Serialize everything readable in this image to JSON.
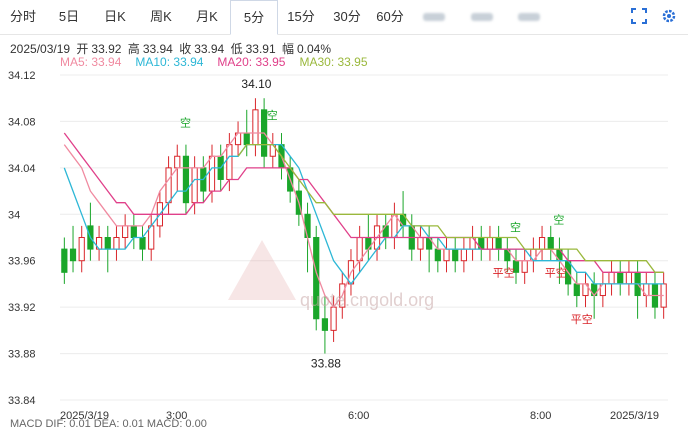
{
  "tabs": [
    {
      "label": "分时",
      "active": false,
      "blurred": false,
      "w": 46
    },
    {
      "label": "5日",
      "active": false,
      "blurred": false,
      "w": 46
    },
    {
      "label": "日K",
      "active": false,
      "blurred": false,
      "w": 46
    },
    {
      "label": "周K",
      "active": false,
      "blurred": false,
      "w": 46
    },
    {
      "label": "月K",
      "active": false,
      "blurred": false,
      "w": 46
    },
    {
      "label": "5分",
      "active": true,
      "blurred": false,
      "w": 46
    },
    {
      "label": "15分",
      "active": false,
      "blurred": false,
      "w": 46
    },
    {
      "label": "30分",
      "active": false,
      "blurred": false,
      "w": 46
    },
    {
      "label": "60分",
      "active": false,
      "blurred": false,
      "w": 40
    },
    {
      "label": "",
      "active": false,
      "blurred": true,
      "w": 48
    },
    {
      "label": "",
      "active": false,
      "blurred": true,
      "w": 48
    },
    {
      "label": "",
      "active": false,
      "blurred": true,
      "w": 46
    }
  ],
  "toolbar": {
    "fullscreen_icon": "fullscreen-icon",
    "settings_icon": "gear-icon"
  },
  "info": {
    "date": "2025/03/19",
    "open_label": "开",
    "open": "33.92",
    "high_label": "高",
    "high": "33.94",
    "close_label": "收",
    "close": "33.94",
    "low_label": "低",
    "low": "33.91",
    "range_label": "幅",
    "range": "0.04%"
  },
  "ma_legend": [
    {
      "label": "MA5: 33.94",
      "color": "#f08aa0"
    },
    {
      "label": "MA10: 33.94",
      "color": "#2db7d6"
    },
    {
      "label": "MA20: 33.95",
      "color": "#e0408a"
    },
    {
      "label": "MA30: 33.95",
      "color": "#9ab83c"
    }
  ],
  "watermark_text": "quote.cngold.org",
  "bottom_labels": "MACD  DIF: 0.01   DEA: 0.01   MACD: 0.00",
  "colors": {
    "up": "#d9252a",
    "down": "#1aa62a",
    "grid": "#ececec",
    "axis": "#333"
  },
  "chart_data": {
    "type": "candlestick",
    "ylim": [
      33.84,
      34.12
    ],
    "y_ticks": [
      "34.12",
      "34.08",
      "34.04",
      "34",
      "33.96",
      "33.92",
      "33.88",
      "33.84"
    ],
    "x_labels": [
      "2025/3/19",
      "3:00",
      "6:00",
      "8:00",
      "2025/3/19"
    ],
    "max_label": "34.10",
    "min_label": "33.88",
    "signals": [
      {
        "text": "空",
        "type": "sell"
      },
      {
        "text": "空",
        "type": "sell"
      },
      {
        "text": "空",
        "type": "sell"
      },
      {
        "text": "空",
        "type": "sell"
      },
      {
        "text": "平空",
        "type": "cover"
      },
      {
        "text": "平空",
        "type": "cover"
      },
      {
        "text": "平空",
        "type": "cover"
      }
    ],
    "candles": [
      [
        33.97,
        33.95,
        33.98,
        33.94
      ],
      [
        33.97,
        33.96,
        33.99,
        33.95
      ],
      [
        33.96,
        33.98,
        33.99,
        33.95
      ],
      [
        33.99,
        33.97,
        34.01,
        33.96
      ],
      [
        33.97,
        33.98,
        33.99,
        33.96
      ],
      [
        33.98,
        33.97,
        33.99,
        33.95
      ],
      [
        33.97,
        33.98,
        33.99,
        33.96
      ],
      [
        33.98,
        33.99,
        34.0,
        33.97
      ],
      [
        33.99,
        33.98,
        34.0,
        33.97
      ],
      [
        33.98,
        33.97,
        33.99,
        33.96
      ],
      [
        33.97,
        33.99,
        34.0,
        33.96
      ],
      [
        33.99,
        34.01,
        34.02,
        33.98
      ],
      [
        34.01,
        34.04,
        34.05,
        34.0
      ],
      [
        34.04,
        34.05,
        34.06,
        34.02
      ],
      [
        34.05,
        34.01,
        34.06,
        34.0
      ],
      [
        34.01,
        34.04,
        34.05,
        34.0
      ],
      [
        34.04,
        34.02,
        34.05,
        34.01
      ],
      [
        34.02,
        34.05,
        34.06,
        34.01
      ],
      [
        34.05,
        34.03,
        34.06,
        34.02
      ],
      [
        34.03,
        34.06,
        34.07,
        34.02
      ],
      [
        34.06,
        34.07,
        34.08,
        34.05
      ],
      [
        34.07,
        34.06,
        34.09,
        34.05
      ],
      [
        34.06,
        34.09,
        34.1,
        34.05
      ],
      [
        34.09,
        34.05,
        34.1,
        34.04
      ],
      [
        34.05,
        34.06,
        34.07,
        34.04
      ],
      [
        34.06,
        34.04,
        34.07,
        34.03
      ],
      [
        34.04,
        34.02,
        34.05,
        34.01
      ],
      [
        34.02,
        34.0,
        34.03,
        33.99
      ],
      [
        34.0,
        33.98,
        34.01,
        33.95
      ],
      [
        33.98,
        33.91,
        33.99,
        33.9
      ],
      [
        33.91,
        33.9,
        33.93,
        33.88
      ],
      [
        33.9,
        33.92,
        33.93,
        33.89
      ],
      [
        33.92,
        33.94,
        33.95,
        33.91
      ],
      [
        33.94,
        33.96,
        33.97,
        33.93
      ],
      [
        33.96,
        33.98,
        33.99,
        33.95
      ],
      [
        33.98,
        33.97,
        34.0,
        33.96
      ],
      [
        33.97,
        33.99,
        34.0,
        33.96
      ],
      [
        33.99,
        33.98,
        34.0,
        33.97
      ],
      [
        33.98,
        34.0,
        34.01,
        33.97
      ],
      [
        34.0,
        33.99,
        34.02,
        33.98
      ],
      [
        33.99,
        33.97,
        34.0,
        33.96
      ],
      [
        33.97,
        33.98,
        33.99,
        33.96
      ],
      [
        33.98,
        33.97,
        33.99,
        33.95
      ],
      [
        33.97,
        33.96,
        33.98,
        33.95
      ],
      [
        33.96,
        33.97,
        33.98,
        33.95
      ],
      [
        33.97,
        33.96,
        33.98,
        33.95
      ],
      [
        33.96,
        33.97,
        33.98,
        33.95
      ],
      [
        33.97,
        33.98,
        33.99,
        33.96
      ],
      [
        33.98,
        33.97,
        33.99,
        33.96
      ],
      [
        33.97,
        33.98,
        33.99,
        33.96
      ],
      [
        33.98,
        33.97,
        33.99,
        33.96
      ],
      [
        33.97,
        33.96,
        33.98,
        33.95
      ],
      [
        33.96,
        33.95,
        33.97,
        33.94
      ],
      [
        33.95,
        33.96,
        33.97,
        33.94
      ],
      [
        33.96,
        33.97,
        33.98,
        33.95
      ],
      [
        33.97,
        33.98,
        33.99,
        33.96
      ],
      [
        33.98,
        33.97,
        33.99,
        33.96
      ],
      [
        33.97,
        33.96,
        33.98,
        33.94
      ],
      [
        33.96,
        33.94,
        33.97,
        33.93
      ],
      [
        33.94,
        33.93,
        33.95,
        33.92
      ],
      [
        33.93,
        33.94,
        33.95,
        33.92
      ],
      [
        33.94,
        33.93,
        33.95,
        33.91
      ],
      [
        33.93,
        33.94,
        33.95,
        33.92
      ],
      [
        33.94,
        33.95,
        33.96,
        33.93
      ],
      [
        33.95,
        33.94,
        33.96,
        33.93
      ],
      [
        33.94,
        33.95,
        33.96,
        33.93
      ],
      [
        33.95,
        33.93,
        33.96,
        33.91
      ],
      [
        33.93,
        33.94,
        33.95,
        33.92
      ],
      [
        33.94,
        33.92,
        33.95,
        33.91
      ],
      [
        33.92,
        33.94,
        33.95,
        33.91
      ]
    ],
    "ma_series": [
      {
        "name": "MA5",
        "color": "#f08aa0",
        "values": [
          34.06,
          34.05,
          34.04,
          34.02,
          34.01,
          34.0,
          33.99,
          33.99,
          33.99,
          33.99,
          34.0,
          34.02,
          34.03,
          34.04,
          34.04,
          34.04,
          34.04,
          34.05,
          34.05,
          34.06,
          34.07,
          34.07,
          34.07,
          34.07,
          34.06,
          34.05,
          34.03,
          34.01,
          33.98,
          33.95,
          33.93,
          33.92,
          33.93,
          33.95,
          33.96,
          33.97,
          33.98,
          33.99,
          34.0,
          33.99,
          33.99,
          33.98,
          33.98,
          33.97,
          33.97,
          33.97,
          33.97,
          33.97,
          33.97,
          33.97,
          33.97,
          33.97,
          33.96,
          33.96,
          33.96,
          33.97,
          33.97,
          33.96,
          33.95,
          33.94,
          33.94,
          33.93,
          33.94,
          33.94,
          33.94,
          33.94,
          33.94,
          33.93,
          33.93,
          33.93
        ]
      },
      {
        "name": "MA10",
        "color": "#2db7d6",
        "values": [
          34.04,
          34.02,
          34.0,
          33.98,
          33.97,
          33.97,
          33.97,
          33.97,
          33.98,
          33.98,
          33.99,
          34.0,
          34.01,
          34.02,
          34.02,
          34.03,
          34.03,
          34.04,
          34.04,
          34.05,
          34.05,
          34.06,
          34.06,
          34.06,
          34.06,
          34.06,
          34.05,
          34.04,
          34.02,
          34.0,
          33.98,
          33.96,
          33.95,
          33.94,
          33.95,
          33.96,
          33.97,
          33.98,
          33.98,
          33.99,
          33.99,
          33.99,
          33.98,
          33.98,
          33.97,
          33.97,
          33.97,
          33.97,
          33.97,
          33.97,
          33.97,
          33.97,
          33.97,
          33.97,
          33.96,
          33.96,
          33.96,
          33.96,
          33.96,
          33.95,
          33.95,
          33.94,
          33.94,
          33.94,
          33.94,
          33.94,
          33.94,
          33.94,
          33.94,
          33.94
        ]
      },
      {
        "name": "MA20",
        "color": "#e0408a",
        "values": [
          34.07,
          34.06,
          34.05,
          34.04,
          34.03,
          34.02,
          34.01,
          34.01,
          34.0,
          34.0,
          34.0,
          34.0,
          34.0,
          34.0,
          34.0,
          34.01,
          34.01,
          34.02,
          34.02,
          34.03,
          34.03,
          34.04,
          34.04,
          34.04,
          34.04,
          34.04,
          34.04,
          34.03,
          34.03,
          34.02,
          34.01,
          34.0,
          33.99,
          33.98,
          33.98,
          33.98,
          33.98,
          33.98,
          33.98,
          33.98,
          33.98,
          33.98,
          33.98,
          33.98,
          33.98,
          33.98,
          33.98,
          33.98,
          33.97,
          33.97,
          33.97,
          33.97,
          33.97,
          33.97,
          33.97,
          33.97,
          33.97,
          33.97,
          33.96,
          33.96,
          33.96,
          33.96,
          33.95,
          33.95,
          33.95,
          33.95,
          33.95,
          33.95,
          33.95,
          33.95
        ]
      },
      {
        "name": "MA30",
        "color": "#9ab83c",
        "values": [
          null,
          null,
          null,
          null,
          null,
          null,
          null,
          null,
          null,
          null,
          null,
          null,
          null,
          null,
          null,
          null,
          null,
          null,
          null,
          null,
          34.05,
          34.06,
          34.06,
          34.06,
          34.06,
          34.05,
          34.04,
          34.03,
          34.02,
          34.01,
          34.01,
          34.0,
          34.0,
          34.0,
          34.0,
          34.0,
          34.0,
          34.0,
          34.0,
          34.0,
          33.99,
          33.99,
          33.99,
          33.99,
          33.98,
          33.98,
          33.98,
          33.98,
          33.98,
          33.98,
          33.98,
          33.98,
          33.98,
          33.97,
          33.97,
          33.97,
          33.97,
          33.97,
          33.97,
          33.97,
          33.96,
          33.96,
          33.96,
          33.96,
          33.96,
          33.96,
          33.96,
          33.96,
          33.95,
          33.95
        ]
      }
    ]
  }
}
